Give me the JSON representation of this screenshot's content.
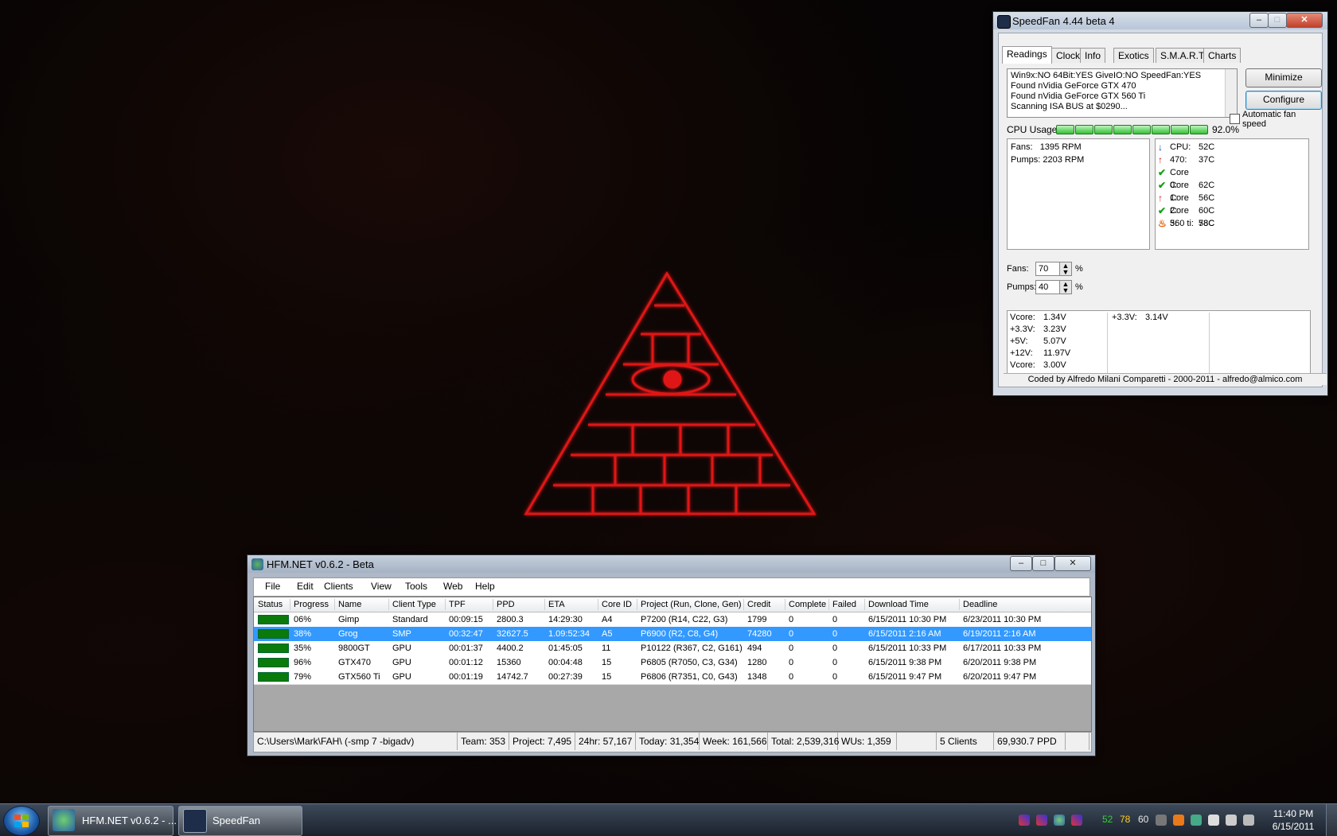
{
  "speedfan": {
    "title": "SpeedFan 4.44 beta 4",
    "tabs": [
      "Readings",
      "Clock",
      "Info",
      "Exotics",
      "S.M.A.R.T.",
      "Charts"
    ],
    "log": [
      "Win9x:NO  64Bit:YES  GiveIO:NO  SpeedFan:YES",
      "Found nVidia GeForce GTX 470",
      "Found nVidia GeForce GTX 560 Ti",
      "Scanning ISA BUS at $0290..."
    ],
    "minimize_label": "Minimize",
    "configure_label": "Configure",
    "auto_fan_label": "Automatic fan speed",
    "cpu_usage_label": "CPU Usage",
    "cpu_usage_value": "92.0%",
    "cpu_usage_fraction": 0.92,
    "fans_readings": [
      {
        "label": "Fans:",
        "value": "1395 RPM"
      },
      {
        "label": "Pumps:",
        "value": "2203 RPM"
      }
    ],
    "temps": [
      {
        "label": "CPU:",
        "value": "52C",
        "icon": "arrow-down-icon",
        "color": "#1a3fcc"
      },
      {
        "label": "470:",
        "value": "37C",
        "icon": "arrow-up-icon",
        "color": "#d01010"
      },
      {
        "label": "Core 0:",
        "value": "62C",
        "icon": "check-icon",
        "color": "#16a016"
      },
      {
        "label": "Core 1:",
        "value": "56C",
        "icon": "check-icon",
        "color": "#16a016"
      },
      {
        "label": "Core 2:",
        "value": "60C",
        "icon": "arrow-up-icon",
        "color": "#d01010"
      },
      {
        "label": "Core 3:",
        "value": "58C",
        "icon": "check-icon",
        "color": "#16a016"
      },
      {
        "label": "560 ti:",
        "value": "78C",
        "icon": "flame-icon",
        "color": "#e05a00"
      }
    ],
    "fan_speed": [
      {
        "label": "Fans:",
        "value": "70",
        "unit": "%"
      },
      {
        "label": "Pumps:",
        "value": "40",
        "unit": "%"
      }
    ],
    "voltages_col1": [
      {
        "label": "Vcore:",
        "value": "1.34V"
      },
      {
        "label": "+3.3V:",
        "value": "3.23V"
      },
      {
        "label": "+5V:",
        "value": "5.07V"
      },
      {
        "label": "+12V:",
        "value": "11.97V"
      },
      {
        "label": "Vcore:",
        "value": "3.00V"
      }
    ],
    "voltages_col2": [
      {
        "label": "+3.3V:",
        "value": "3.14V"
      }
    ],
    "footer": "Coded by Alfredo Milani Comparetti - 2000-2011 - alfredo@almico.com"
  },
  "hfm": {
    "title": "HFM.NET v0.6.2 - Beta",
    "menu": [
      "File",
      "Edit",
      "Clients",
      "View",
      "Tools",
      "Web",
      "Help"
    ],
    "columns": [
      "Status",
      "Progress",
      "Name",
      "Client Type",
      "TPF",
      "PPD",
      "ETA",
      "Core ID",
      "Project (Run, Clone, Gen)",
      "Credit",
      "Complete",
      "Failed",
      "Download Time",
      "Deadline"
    ],
    "rows": [
      [
        "06%",
        "Gimp",
        "Standard",
        "00:09:15",
        "2800.3",
        "14:29:30",
        "A4",
        "P7200 (R14, C22, G3)",
        "1799",
        "0",
        "0",
        "6/15/2011 10:30 PM",
        "6/23/2011 10:30 PM"
      ],
      [
        "38%",
        "Grog",
        "SMP",
        "00:32:47",
        "32627.5",
        "1.09:52:34",
        "A5",
        "P6900 (R2, C8, G4)",
        "74280",
        "0",
        "0",
        "6/15/2011 2:16 AM",
        "6/19/2011 2:16 AM"
      ],
      [
        "35%",
        "9800GT",
        "GPU",
        "00:01:37",
        "4400.2",
        "01:45:05",
        "11",
        "P10122 (R367, C2, G161)",
        "494",
        "0",
        "0",
        "6/15/2011 10:33 PM",
        "6/17/2011 10:33 PM"
      ],
      [
        "96%",
        "GTX470",
        "GPU",
        "00:01:12",
        "15360",
        "00:04:48",
        "15",
        "P6805 (R7050, C3, G34)",
        "1280",
        "0",
        "0",
        "6/15/2011 9:38 PM",
        "6/20/2011 9:38 PM"
      ],
      [
        "79%",
        "GTX560 Ti",
        "GPU",
        "00:01:19",
        "14742.7",
        "00:27:39",
        "15",
        "P6806 (R7351, C0, G43)",
        "1348",
        "0",
        "0",
        "6/15/2011 9:47 PM",
        "6/20/2011 9:47 PM"
      ]
    ],
    "selected_row": 1,
    "status": [
      "C:\\Users\\Mark\\FAH\\ (-smp 7 -bigadv)",
      "Team: 353",
      "Project: 7,495",
      "24hr: 57,167",
      "Today: 31,354",
      "Week: 161,566",
      "Total: 2,539,316",
      "WUs: 1,359",
      "",
      "5 Clients",
      "69,930.7 PPD",
      ""
    ]
  },
  "taskbar": {
    "buttons": [
      {
        "label": "HFM.NET v0.6.2 - ...",
        "icon": "hfm-icon"
      },
      {
        "label": "SpeedFan",
        "icon": "speedfan-icon"
      }
    ],
    "tray_temps": [
      "52",
      "78",
      "60"
    ],
    "time": "11:40 PM",
    "date": "6/15/2011"
  }
}
